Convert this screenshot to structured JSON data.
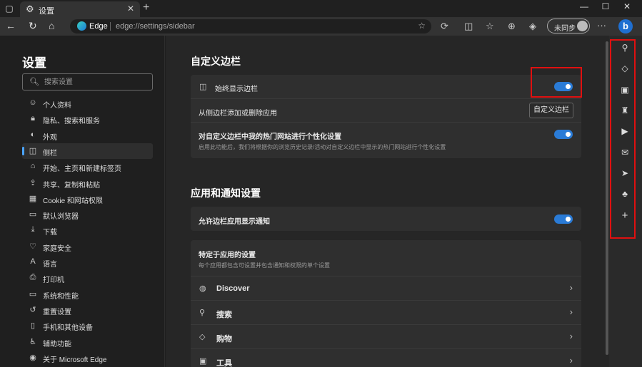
{
  "browser": {
    "tab_title": "设置",
    "url_site": "Edge",
    "url_path": "edge://settings/sidebar",
    "sync_label": "未同步"
  },
  "settings_nav": {
    "title": "设置",
    "search_placeholder": "搜索设置",
    "items": [
      {
        "label": "个人资料",
        "icon": "profile-icon"
      },
      {
        "label": "隐私、搜索和服务",
        "icon": "lock-icon"
      },
      {
        "label": "外观",
        "icon": "appearance-icon"
      },
      {
        "label": "侧栏",
        "icon": "sidebar-icon",
        "active": true
      },
      {
        "label": "开始、主页和新建标签页",
        "icon": "home-icon"
      },
      {
        "label": "共享、复制和粘贴",
        "icon": "share-icon"
      },
      {
        "label": "Cookie 和网站权限",
        "icon": "cookie-icon"
      },
      {
        "label": "默认浏览器",
        "icon": "browser-icon"
      },
      {
        "label": "下载",
        "icon": "download-icon"
      },
      {
        "label": "家庭安全",
        "icon": "family-icon"
      },
      {
        "label": "语言",
        "icon": "language-icon"
      },
      {
        "label": "打印机",
        "icon": "printer-icon"
      },
      {
        "label": "系统和性能",
        "icon": "laptop-icon"
      },
      {
        "label": "重置设置",
        "icon": "reset-icon"
      },
      {
        "label": "手机和其他设备",
        "icon": "phone-icon"
      },
      {
        "label": "辅助功能",
        "icon": "accessibility-icon"
      },
      {
        "label": "关于 Microsoft Edge",
        "icon": "edge-icon"
      }
    ]
  },
  "customize_sidebar": {
    "title": "自定义边栏",
    "always_show_label": "始终显示边栏",
    "always_show_on": true,
    "add_remove_label": "从侧边栏添加或删除应用",
    "customize_button": "自定义边栏",
    "personalize_label": "对自定义边栏中我的热门网站进行个性化设置",
    "personalize_desc": "启用此功能后，我们将根据你的浏览历史记录/活动对自定义边栏中显示的热门网站进行个性化设置",
    "personalize_on": true
  },
  "apps_notifications": {
    "title": "应用和通知设置",
    "allow_notify_label": "允许边栏应用显示通知",
    "allow_notify_on": true,
    "app_specific_label": "特定于应用的设置",
    "app_specific_desc": "每个应用都包含可设置并包含通知和权限的单个设置",
    "apps": [
      {
        "label": "Discover",
        "icon": "discover-icon"
      },
      {
        "label": "搜索",
        "icon": "search-icon"
      },
      {
        "label": "购物",
        "icon": "shopping-tag-icon"
      },
      {
        "label": "工具",
        "icon": "tools-icon"
      }
    ]
  },
  "right_sidebar": {
    "icons": [
      "search-icon",
      "shopping-tag-icon",
      "tools-icon",
      "games-icon",
      "office-icon",
      "outlook-icon",
      "telegram-icon",
      "tree-icon",
      "add-icon"
    ]
  }
}
